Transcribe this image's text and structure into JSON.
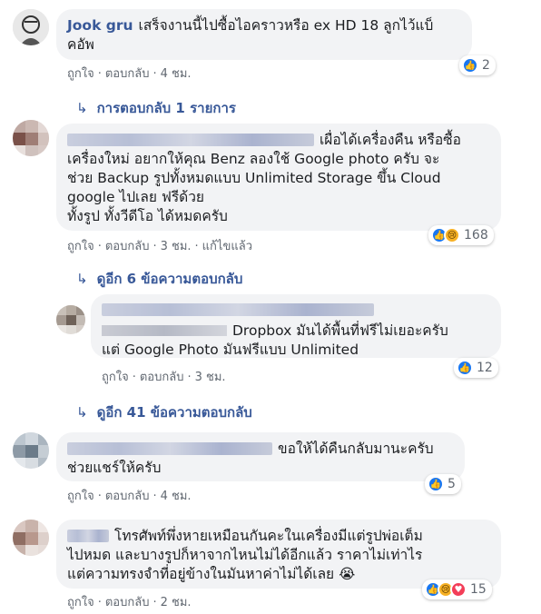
{
  "comments": [
    {
      "author": "Jook gru",
      "text_lines": [
        "เสร็จงานนี้ไปซื้อไอคราวหรือ ex HD 18 ลูกไว้แบ็",
        "คอัพ"
      ],
      "like": "ถูกใจ",
      "reply": "ตอบกลับ",
      "time": "4 ชม.",
      "reaction_count": "2",
      "reactions": [
        "like"
      ]
    },
    {
      "author": "",
      "text_lines": [
        "เผื่อได้เครื่องคืน หรือซื้อ",
        "เครื่องใหม่ อยากให้คุณ Benz ลองใช้ Google photo ครับ จะ",
        "ช่วย Backup รูปทั้งหมดแบบ Unlimited Storage ขึ้น Cloud",
        "google ไปเลย ฟรีด้วย",
        "ทั้งรูป ทั้งวีดีโอ ได้หมดครับ"
      ],
      "like": "ถูกใจ",
      "reply": "ตอบกลับ",
      "time": "3 ชม.",
      "edited": "แก้ไขแล้ว",
      "reaction_count": "168",
      "reactions": [
        "like",
        "sad"
      ]
    },
    {
      "author": "",
      "text_lines": [
        "Dropbox มันได้พื้นที่ฟรีไม่เยอะครับ",
        "แต่ Google Photo มันฟรีแบบ Unlimited"
      ],
      "like": "ถูกใจ",
      "reply": "ตอบกลับ",
      "time": "3 ชม.",
      "reaction_count": "12",
      "reactions": [
        "like"
      ]
    },
    {
      "author": "",
      "text_lines": [
        "ขอให้ได้คืนกลับมานะครับ",
        "ช่วยแชร์ให้ครับ"
      ],
      "like": "ถูกใจ",
      "reply": "ตอบกลับ",
      "time": "4 ชม.",
      "reaction_count": "5",
      "reactions": [
        "like"
      ]
    },
    {
      "author": "",
      "text_lines": [
        "โทรศัพท์พึ่งหายเหมือนกันคะในเครื่องมีแต่รูปพ่อเต็ม",
        "ไปหมด และบางรูปก็หาจากไหนไม่ได้อีกแล้ว ราคาไม่เท่าไร",
        "แต่ความทรงจำที่อยู่ข้างในมันหาค่าไม่ได้เลย 😭"
      ],
      "like": "ถูกใจ",
      "reply": "ตอบกลับ",
      "time": "2 ชม.",
      "reaction_count": "15",
      "reactions": [
        "like",
        "sad",
        "love"
      ]
    }
  ],
  "reply_links": {
    "first": "การตอบกลับ 1 รายการ",
    "second": "ดูอีก 6 ข้อความตอบกลับ",
    "third": "ดูอีก 41 ข้อความตอบกลับ"
  },
  "dot": "·",
  "colors": {
    "link": "#385898",
    "bubble": "#f2f3f5",
    "meta": "#606770",
    "like": "#1877f2"
  }
}
